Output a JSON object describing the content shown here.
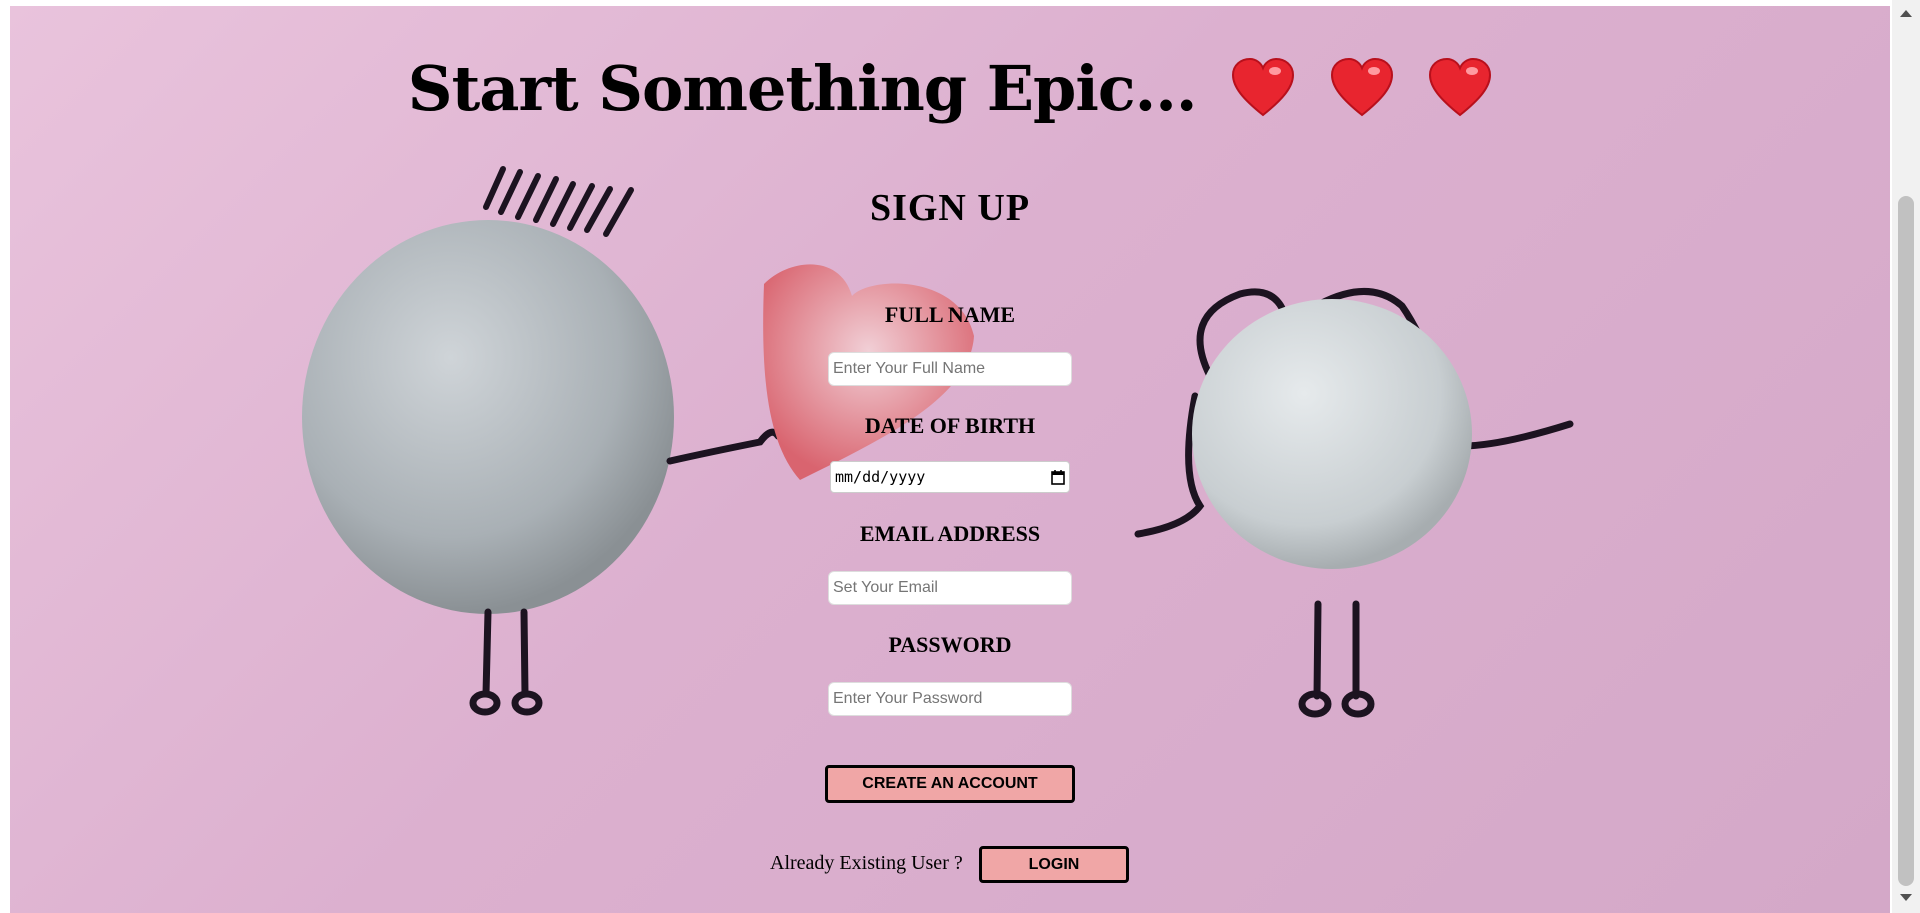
{
  "page": {
    "headline": "Start Something Epic...",
    "headline_hearts": [
      "heart-icon",
      "heart-icon",
      "heart-icon"
    ]
  },
  "form": {
    "title": "SIGN UP",
    "full_name": {
      "label": "FULL NAME",
      "placeholder": "Enter Your Full Name"
    },
    "dob": {
      "label": "DATE OF BIRTH",
      "placeholder": "mm/dd/yyyy"
    },
    "email": {
      "label": "EMAIL ADDRESS",
      "placeholder": "Set Your Email"
    },
    "password": {
      "label": "PASSWORD",
      "placeholder": "Enter Your Password"
    },
    "create_button": "CREATE AN ACCOUNT",
    "existing_text": "Already Existing User ?",
    "login_button": "LOGIN"
  },
  "colors": {
    "background": "#dcb0cf",
    "button": "#f0a6a6",
    "heart": "#e8252f"
  }
}
